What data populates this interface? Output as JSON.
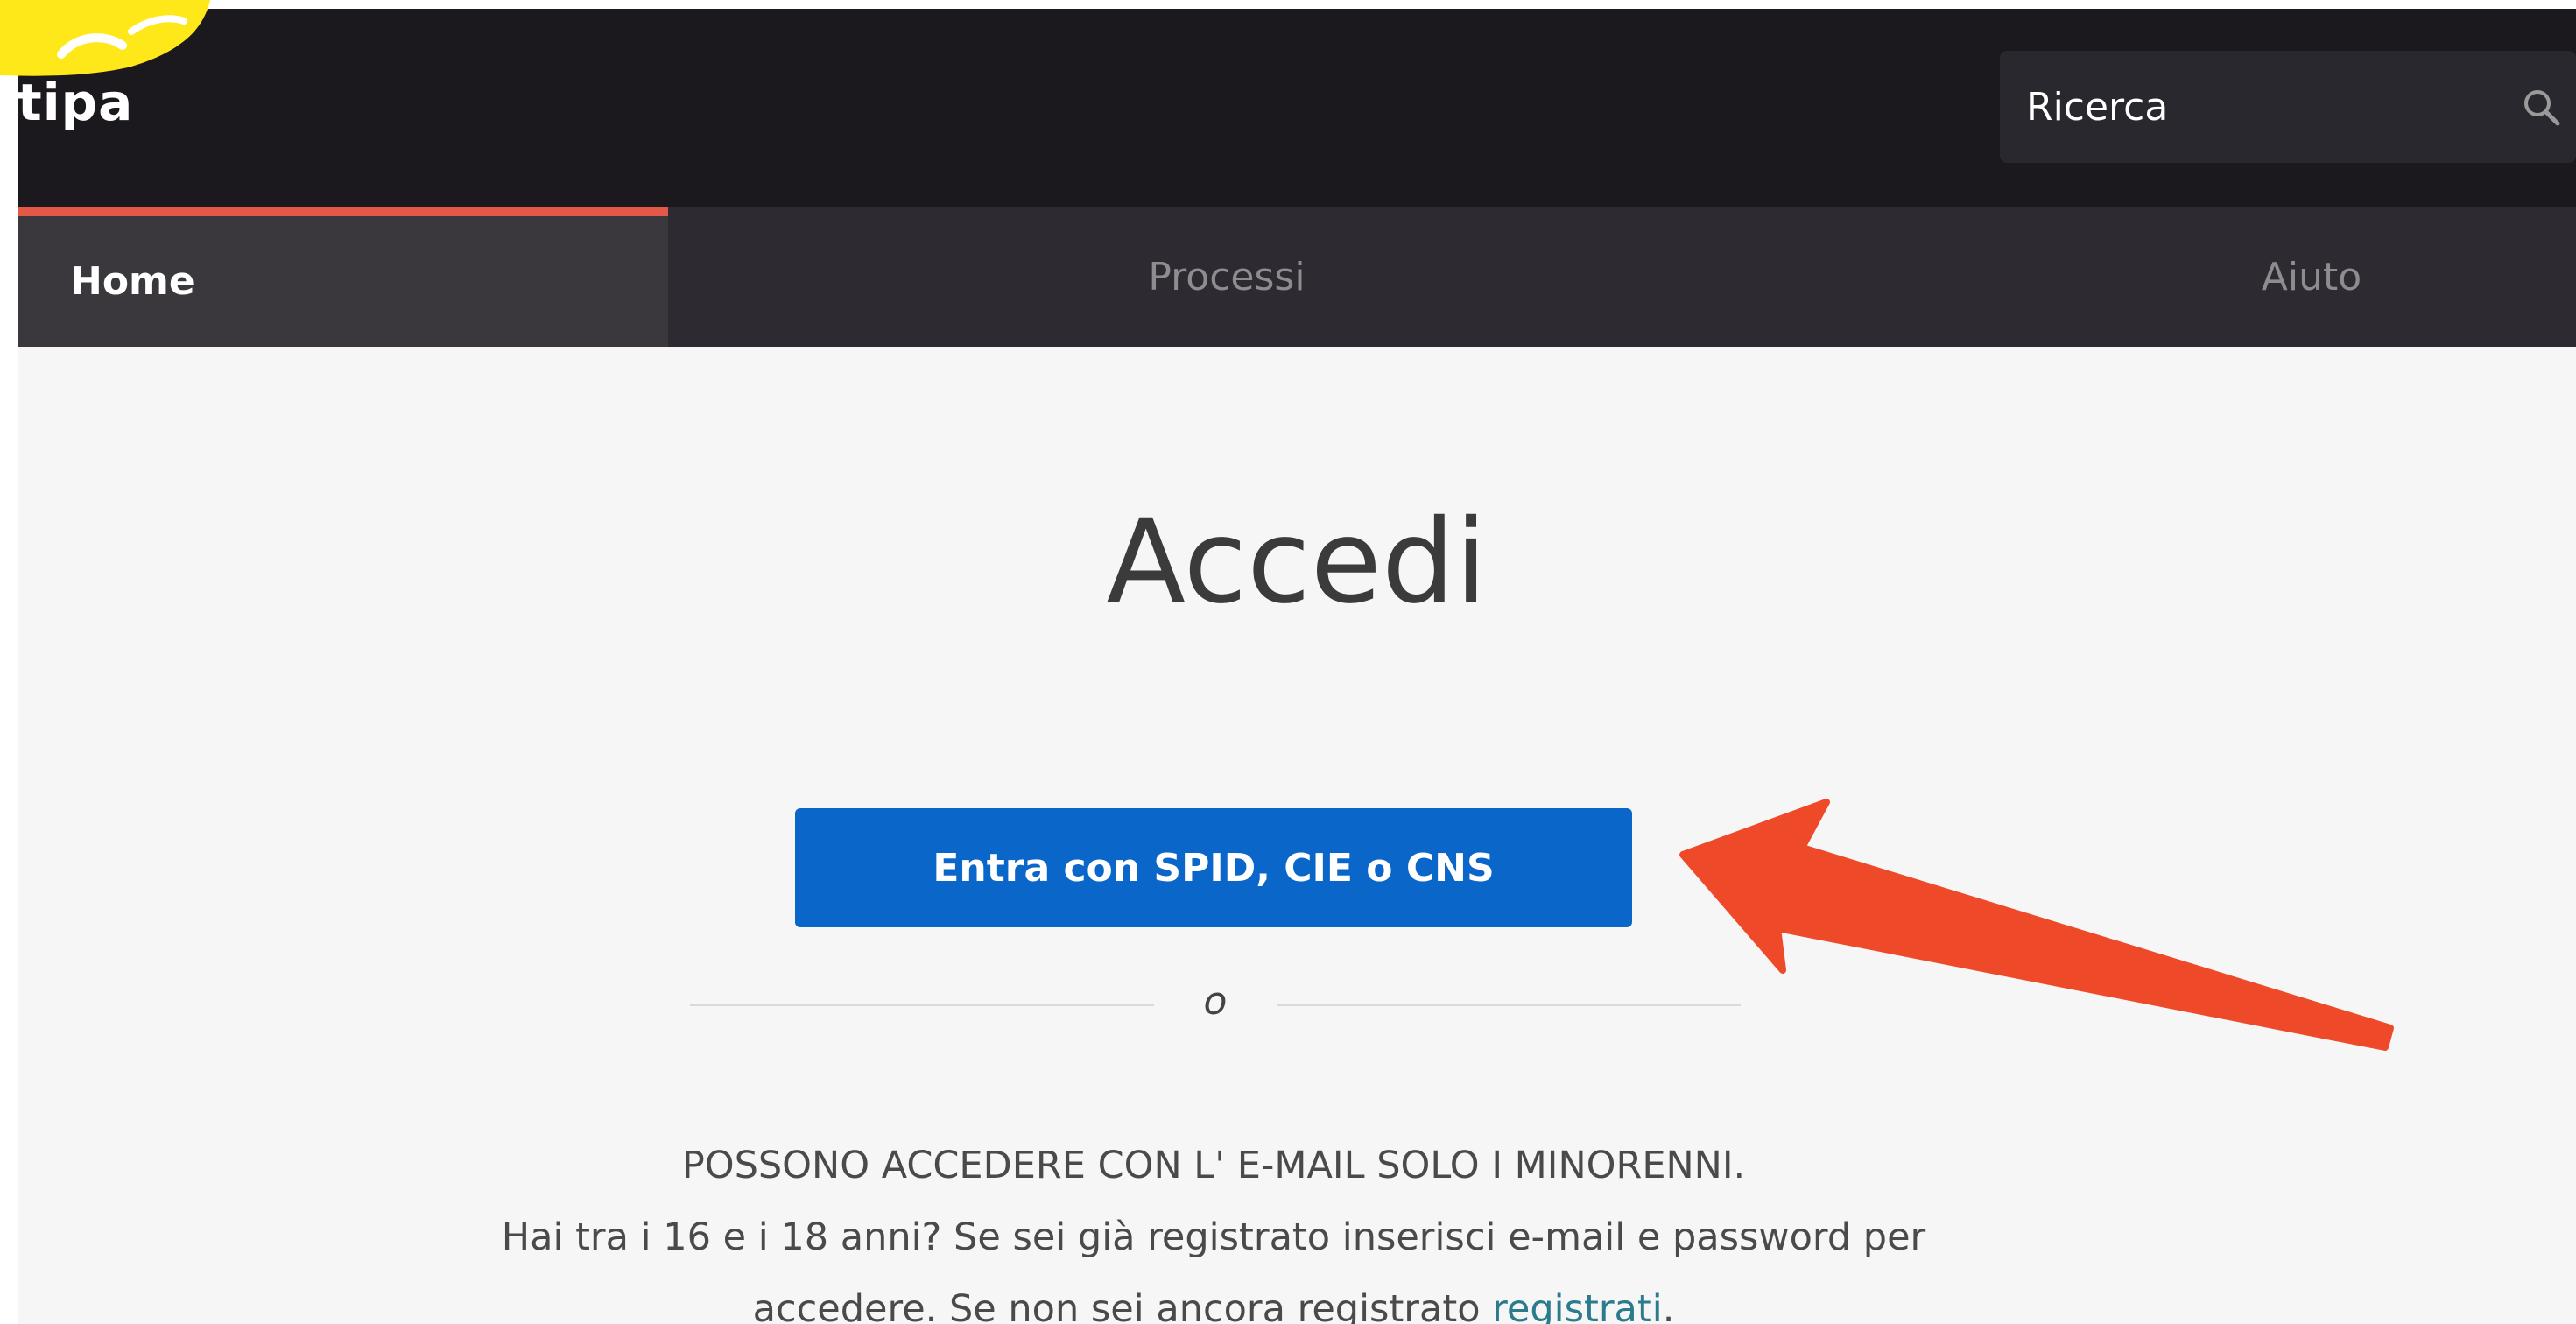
{
  "header": {
    "brand_fragment": "tipa",
    "search": {
      "placeholder": "Ricerca",
      "icon": "search-icon"
    }
  },
  "nav": {
    "items": [
      {
        "label": "Home",
        "active": true
      },
      {
        "label": "Processi",
        "active": false
      },
      {
        "label": "Aiuto",
        "active": false
      }
    ]
  },
  "login": {
    "title": "Accedi",
    "spid_button_label": "Entra con SPID, CIE o CNS",
    "divider_label": "o",
    "info_line1": "POSSONO ACCEDERE CON L' E-MAIL SOLO I MINORENNI.",
    "info_line2_before_break": "Hai tra i 16 e i 18 anni? Se sei già registrato inserisci e-mail e password per",
    "info_line3_before_link": "accedere. Se non sei ancora registrato ",
    "register_link": "registrati",
    "info_line3_after_link": "."
  },
  "colors": {
    "header_bg": "#1b191e",
    "nav_bg": "#2d2b31",
    "active_tab_accent": "#e45847",
    "primary_button": "#0a66c8",
    "link": "#2a7b8c",
    "annotation_arrow": "#ee4a2a",
    "logo_blob": "#ffe81a"
  }
}
